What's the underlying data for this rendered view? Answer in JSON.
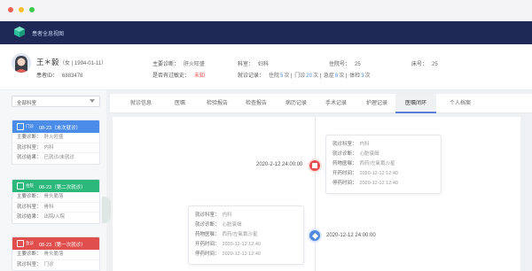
{
  "app": {
    "title": "患者全息视图"
  },
  "patient": {
    "name": "王＊毅",
    "sub": "（女 | 1994-01-11）",
    "id_label": "患者ID：",
    "id_value": "6883478",
    "diagnosis_label": "主要诊断：",
    "diagnosis_value": "肝火旺盛",
    "allergy_label": "是否有过敏史：",
    "allergy_value": "未知",
    "dept_label": "科室：",
    "dept_value": "妇科",
    "admission_label": "住院号：",
    "admission_value": "25",
    "bed_label": "床号：",
    "bed_value": "25",
    "record_label": "就诊记录：",
    "record_items": [
      {
        "label": "住院",
        "count": "5",
        "unit": "次"
      },
      {
        "label": "门诊",
        "count": "20",
        "unit": "次"
      },
      {
        "label": "急症",
        "count": "8",
        "unit": "次"
      },
      {
        "label": "体检",
        "count": "3",
        "unit": "次"
      }
    ]
  },
  "sidebar": {
    "dept_filter": "全部科室",
    "cards": [
      {
        "type": "门诊",
        "date": "08-23（末次就诊）",
        "color": "#4a8ce8",
        "rows": [
          {
            "label": "主要诊断：",
            "value": "肝火旺盛"
          },
          {
            "label": "就诊科室：",
            "value": "内科"
          },
          {
            "label": "就诊结果：",
            "value": "已就诊/未就诊"
          }
        ]
      },
      {
        "type": "住院",
        "date": "08-23（第二次就诊）",
        "color": "#2bb87a",
        "rows": [
          {
            "label": "主要诊断：",
            "value": "骨头脆落"
          },
          {
            "label": "就诊科室：",
            "value": "骨科"
          },
          {
            "label": "就诊结果：",
            "value": "出院/入院"
          }
        ]
      },
      {
        "type": "急诊",
        "date": "08-23（第一次就诊）",
        "color": "#e04e4e",
        "rows": [
          {
            "label": "主要诊断：",
            "value": "骨头脆落"
          },
          {
            "label": "就诊科室：",
            "value": "门诊"
          }
        ]
      }
    ]
  },
  "tabs": [
    "就诊信息",
    "医嘱",
    "检验报告",
    "检查报告",
    "病历记录",
    "手术记录",
    "护理记录",
    "医嘱闭环",
    "个人档案"
  ],
  "active_tab": "医嘱闭环",
  "timeline": {
    "events": [
      {
        "time": "2020-2-12 24:00:00",
        "rows": [
          {
            "label": "就诊科室：",
            "value": "内科"
          },
          {
            "label": "就诊诊断：",
            "value": "心脏衰竭"
          },
          {
            "label": "药物医嘱：",
            "value": "西药/左氧氟沙星"
          },
          {
            "label": "开药时间：",
            "value": "2020-12-12 12:40"
          },
          {
            "label": "停药时间：",
            "value": "2020-12-12 12:40"
          }
        ]
      },
      {
        "time": "2020-12-12 24:00:00",
        "rows": [
          {
            "label": "就诊科室：",
            "value": "内科"
          },
          {
            "label": "就诊诊断：",
            "value": "心脏衰竭"
          },
          {
            "label": "药物医嘱：",
            "value": "西药/左氧氟沙星"
          },
          {
            "label": "开药时间：",
            "value": "2020-12-12 12:40"
          },
          {
            "label": "停药时间：",
            "value": "2020-12-12 12:40"
          }
        ]
      }
    ]
  }
}
